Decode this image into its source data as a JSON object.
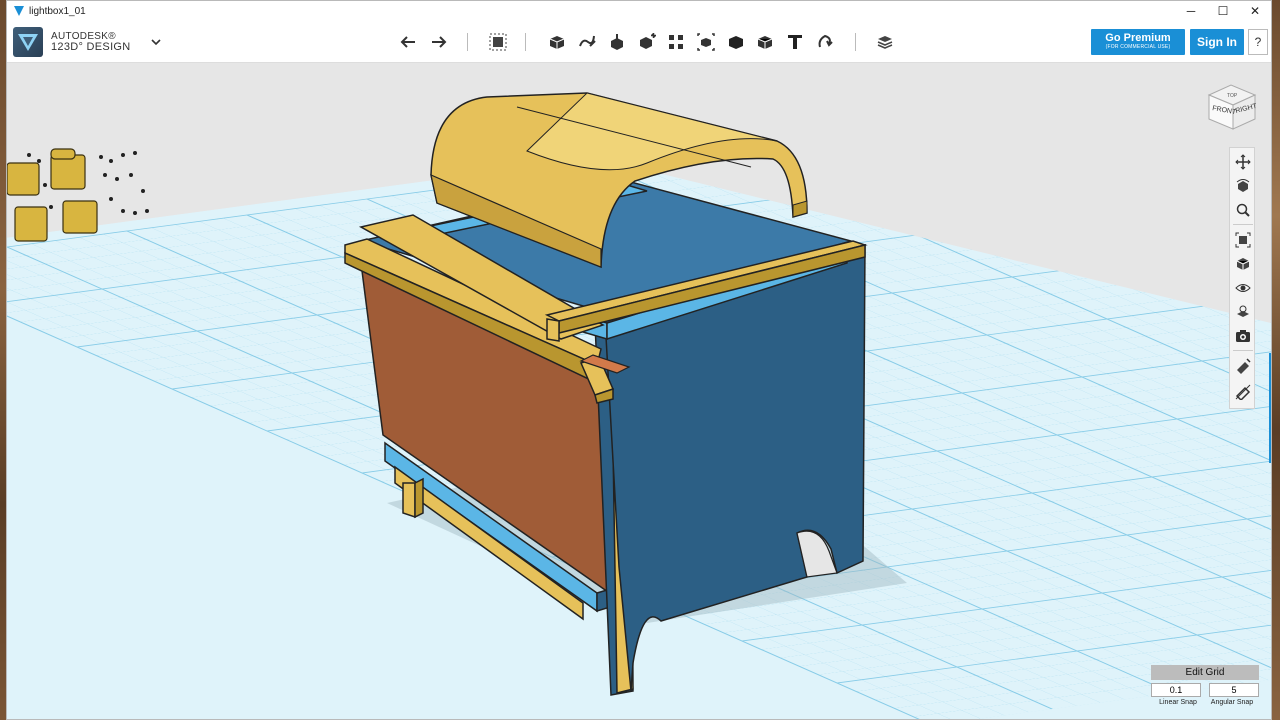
{
  "window": {
    "title": "lightbox1_01",
    "minimize": "─",
    "maximize": "☐",
    "close": "✕"
  },
  "brand": {
    "line1": "AUTODESK®",
    "line2": "123D° DESIGN",
    "menu_icon": "chevron-down-icon"
  },
  "toolbar": {
    "undo_icon": "undo-icon",
    "redo_icon": "redo-icon",
    "tools": [
      "transform-icon",
      "primitives-icon",
      "sketch-icon",
      "construct-icon",
      "modify-icon",
      "pattern-icon",
      "group-icon",
      "combine-icon",
      "measure-icon",
      "text-icon",
      "snap-icon",
      "material-icon"
    ]
  },
  "account": {
    "premium_label": "Go Premium",
    "premium_sub": "(FOR COMMERCIAL USE)",
    "signin_label": "Sign In",
    "help_label": "?"
  },
  "viewcube": {
    "front": "FRONT",
    "right": "RIGHT",
    "top": "TOP"
  },
  "navbar": {
    "tools": [
      "pan-icon",
      "orbit-icon",
      "zoom-icon",
      "fit-icon",
      "view-icon",
      "visibility-icon",
      "materials-icon",
      "camera-icon",
      "snap-tool-icon",
      "constraint-icon"
    ]
  },
  "grid": {
    "edit_label": "Edit Grid",
    "linear_snap_value": "0.1",
    "angular_snap_value": "5",
    "linear_snap_label": "Linear Snap",
    "angular_snap_label": "Angular Snap"
  },
  "colors": {
    "accent": "#1a8fd6",
    "wood_yellow": "#e6c15a",
    "panel_blue": "#2c5f85",
    "light_blue": "#5bb6e6",
    "orange": "#a05c37",
    "grid_line": "#8ed0ea"
  }
}
